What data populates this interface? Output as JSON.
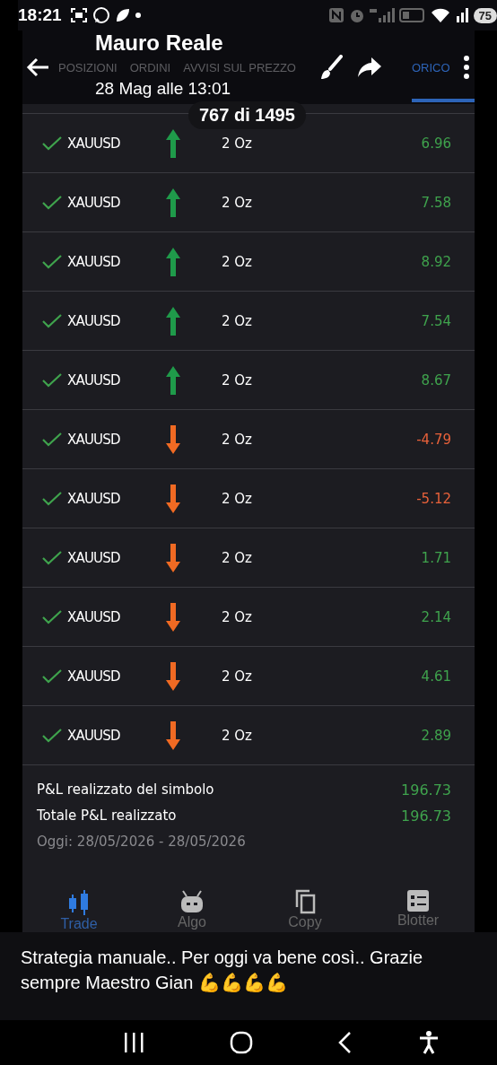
{
  "status_bar": {
    "time": "18:21",
    "battery": "75"
  },
  "header": {
    "title": "Mauro Reale",
    "subtitle": "28 Mag alle 13:01"
  },
  "tabs": [
    {
      "label": "POSIZIONI",
      "selected": false
    },
    {
      "label": "ORDINI",
      "selected": false
    },
    {
      "label": "AVVISI SUL PREZZO",
      "selected": false
    },
    {
      "label": "ORICO",
      "selected": true
    }
  ],
  "counter": "767 di 1495",
  "trades": [
    {
      "symbol": "XAUUSD",
      "kind": "up",
      "quantity": "2 Oz",
      "pnl": "6.96",
      "color": "#3fa34d"
    },
    {
      "symbol": "XAUUSD",
      "kind": "up",
      "quantity": "2 Oz",
      "pnl": "7.58",
      "color": "#3fa34d"
    },
    {
      "symbol": "XAUUSD",
      "kind": "up",
      "quantity": "2 Oz",
      "pnl": "8.92",
      "color": "#3fa34d"
    },
    {
      "symbol": "XAUUSD",
      "kind": "up",
      "quantity": "2 Oz",
      "pnl": "7.54",
      "color": "#3fa34d"
    },
    {
      "symbol": "XAUUSD",
      "kind": "up",
      "quantity": "2 Oz",
      "pnl": "8.67",
      "color": "#3fa34d"
    },
    {
      "symbol": "XAUUSD",
      "kind": "down",
      "quantity": "2 Oz",
      "pnl": "-4.79",
      "color": "#e8613a"
    },
    {
      "symbol": "XAUUSD",
      "kind": "down",
      "quantity": "2 Oz",
      "pnl": "-5.12",
      "color": "#e8613a"
    },
    {
      "symbol": "XAUUSD",
      "kind": "down",
      "quantity": "2 Oz",
      "pnl": "1.71",
      "color": "#3fa34d"
    },
    {
      "symbol": "XAUUSD",
      "kind": "down",
      "quantity": "2 Oz",
      "pnl": "2.14",
      "color": "#3fa34d"
    },
    {
      "symbol": "XAUUSD",
      "kind": "down",
      "quantity": "2 Oz",
      "pnl": "4.61",
      "color": "#3fa34d"
    },
    {
      "symbol": "XAUUSD",
      "kind": "down",
      "quantity": "2 Oz",
      "pnl": "2.89",
      "color": "#3fa34d"
    }
  ],
  "summary": [
    {
      "label": "P&L realizzato del simbolo",
      "value": "196.73"
    },
    {
      "label": "Totale P&L realizzato",
      "value": "196.73"
    }
  ],
  "period": "Oggi: 28/05/2026 - 28/05/2026",
  "bottom_nav": [
    {
      "label": "Trade",
      "kind": "trade",
      "selected": true
    },
    {
      "label": "Algo",
      "kind": "algo",
      "selected": false
    },
    {
      "label": "Copy",
      "kind": "copy",
      "selected": false
    },
    {
      "label": "Blotter",
      "kind": "blotter",
      "selected": false
    }
  ],
  "caption": "Strategia manuale.. Per oggi va bene così.. Grazie sempre Maestro Gian 💪💪💪💪"
}
